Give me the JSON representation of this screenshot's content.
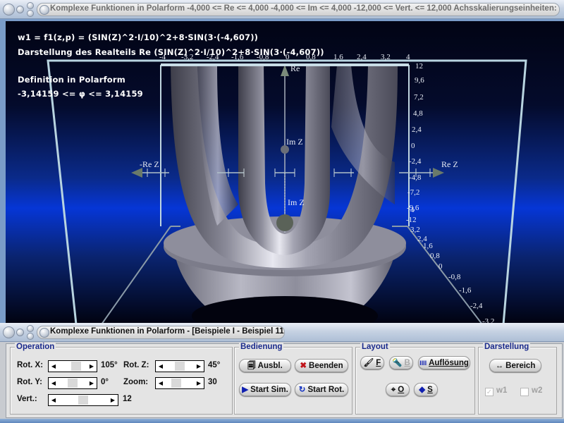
{
  "graph_window": {
    "title": "Komplexe Funktionen in Polarform    -4,000 <= Re <= 4,000   -4,000 <= Im <= 4,000   -12,000 <= Vert. <= 12,000   Achsskalierungseinheiten: ..."
  },
  "control_window": {
    "title": "Komplexe Funktionen in Polarform - [Beispiele I - Beispiel 11]"
  },
  "plot": {
    "overlay": {
      "function_line": "w1 = f1(z,p) = (SIN(Z)^2·I/10)^2+8·SIN(3·(-4,607))",
      "display_line": "Darstellung des Realteils Re (SIN(Z)^2·I/10)^2+8·SIN(3·(-4,607))",
      "definition_title": "Definition in Polarform",
      "definition_range": "-3,14159 <=  φ  <= 3,14159"
    },
    "axes": {
      "re_pos": "Re Z",
      "re_neg": "-Re Z",
      "im_pos": "Im Z",
      "im_neg": "Im Z",
      "vertical": "Re",
      "re_ticks": [
        "-4",
        "-3,2",
        "-2,4",
        "-1,6",
        "-0,8",
        "0",
        "0,8",
        "1,6",
        "2,4",
        "3,2",
        "4"
      ],
      "vert_ticks": [
        "12",
        "9,6",
        "7,2",
        "4,8",
        "2,4",
        "0",
        "-2,4",
        "-4,8",
        "-7,2",
        "-9,6",
        "-12"
      ],
      "im_ticks": [
        "4",
        "3,2",
        "2,4",
        "1,6",
        "0,8",
        "0",
        "-0,8",
        "-1,6",
        "-2,4",
        "-3,2"
      ]
    },
    "colors": {
      "background_top": "#020414",
      "background_mid": "#0636d6",
      "surface": "#9a9aa8",
      "frame": "#b8d4e0"
    }
  },
  "panel": {
    "operation": {
      "title": "Operation",
      "rot_x": {
        "label": "Rot. X:",
        "value": "105°"
      },
      "rot_z": {
        "label": "Rot. Z:",
        "value": "45°"
      },
      "rot_y": {
        "label": "Rot. Y:",
        "value": "0°"
      },
      "zoom": {
        "label": "Zoom:",
        "value": "30"
      },
      "vert": {
        "label": "Vert.:",
        "value": "12"
      }
    },
    "bedienung": {
      "title": "Bedienung",
      "ausbl": "Ausbl.",
      "beenden": "Beenden",
      "start_sim": "Start Sim.",
      "start_rot": "Start Rot."
    },
    "layout": {
      "title": "Layout",
      "f": "F",
      "b": "B",
      "aufloesung": "Auflösung",
      "o": "O",
      "s": "S"
    },
    "darstellung": {
      "title": "Darstellung",
      "bereich": "Bereich",
      "w1": {
        "label": "w1",
        "checked": true
      },
      "w2": {
        "label": "w2",
        "checked": false
      }
    }
  }
}
